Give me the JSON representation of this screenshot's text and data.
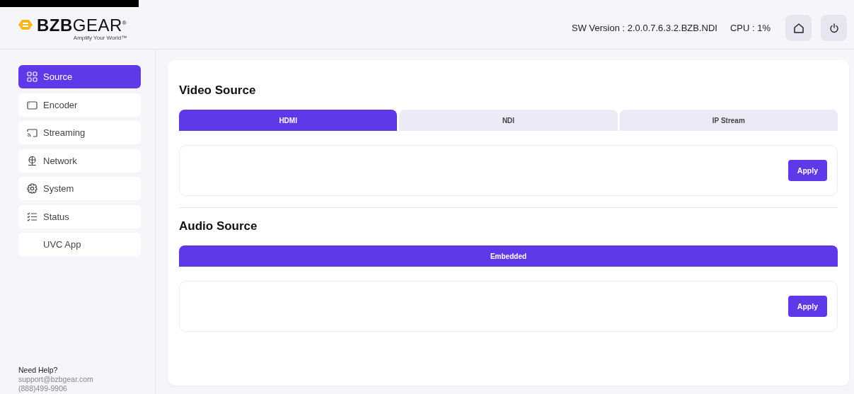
{
  "header": {
    "logo": "**BZB**GEAR$^{®}$",
    "tagline": "Amplify Your World™",
    "sw_version": "SW Version : 2.0.0.7.6.3.2.BZB.NDI",
    "cpu": "CPU : 1%"
  },
  "sidebar": {
    "items": [
      {
        "label": "Source",
        "selected": true
      },
      {
        "label": "Encoder",
        "selected": false
      },
      {
        "label": "Streaming",
        "selected": false
      },
      {
        "label": "Network",
        "selected": false
      },
      {
        "label": "System",
        "selected": false
      },
      {
        "label": "Status",
        "selected": false
      },
      {
        "label": "UVC App",
        "selected": false
      }
    ],
    "help": {
      "title": "Need Help?",
      "email": "support@bzbgear.com",
      "phone": "(888)499-9906"
    }
  },
  "sections": [
    {
      "title": "Video Source",
      "tabs": [
        {
          "label": "HDMI",
          "selected": true
        },
        {
          "label": "NDI",
          "selected": false
        },
        {
          "label": "IP Stream",
          "selected": false
        }
      ],
      "button": "Apply"
    },
    {
      "title": "Audio Source",
      "tabs": [
        {
          "label": "Embedded",
          "selected": true
        }
      ],
      "button": "Apply"
    }
  ]
}
